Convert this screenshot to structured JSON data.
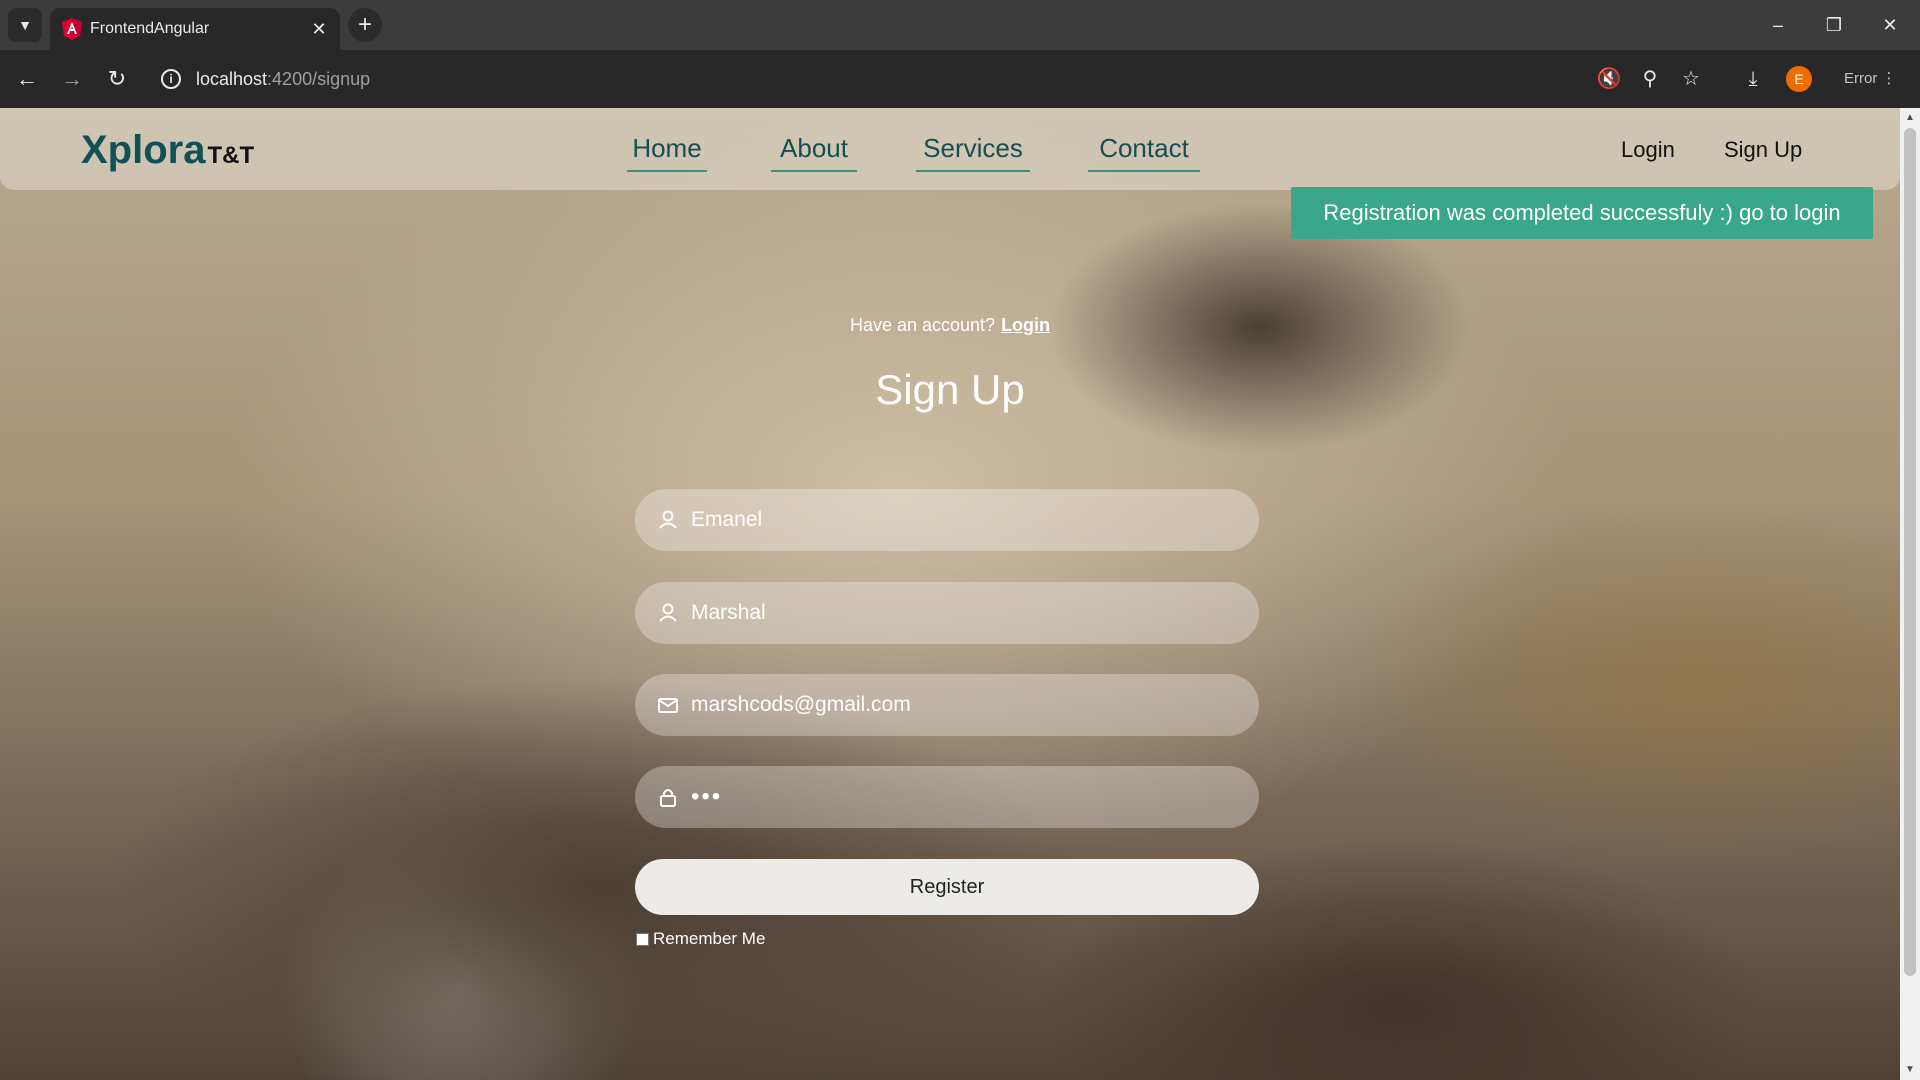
{
  "browser": {
    "tab_title": "FrontendAngular",
    "url_host": "localhost",
    "url_path": ":4200/signup",
    "profile_initial": "E",
    "error_label": "Error",
    "brand_color": "#dd0031"
  },
  "navbar": {
    "logo": "Xplora",
    "logo_suffix": "T&T",
    "links": [
      "Home",
      "About",
      "Services",
      "Contact"
    ],
    "login": "Login",
    "signup": "Sign Up"
  },
  "toast": {
    "message": "Registration was completed successfuly :) go to login",
    "color": "#3aa78a"
  },
  "form": {
    "have_account": "Have an account?",
    "login_link": "Login",
    "title": "Sign Up",
    "first_name": "Emanel",
    "last_name": "Marshal",
    "email": "marshcods@gmail.com",
    "password_mask": "•••",
    "register": "Register",
    "remember_me": "Remember Me"
  }
}
